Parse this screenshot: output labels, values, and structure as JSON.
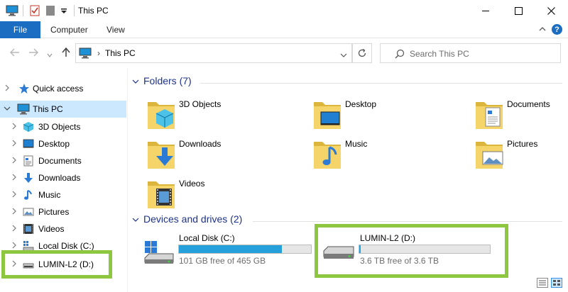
{
  "window": {
    "title": "This PC"
  },
  "ribbon": {
    "tabs": [
      "File",
      "Computer",
      "View"
    ]
  },
  "address": {
    "path": "This PC"
  },
  "search": {
    "placeholder": "Search This PC"
  },
  "nav": {
    "items": [
      {
        "label": "Quick access",
        "icon": "star-icon"
      },
      {
        "label": "This PC",
        "icon": "computer-icon"
      },
      {
        "label": "3D Objects",
        "icon": "3d-objects-icon"
      },
      {
        "label": "Desktop",
        "icon": "desktop-icon"
      },
      {
        "label": "Documents",
        "icon": "documents-icon"
      },
      {
        "label": "Downloads",
        "icon": "downloads-icon"
      },
      {
        "label": "Music",
        "icon": "music-icon"
      },
      {
        "label": "Pictures",
        "icon": "pictures-icon"
      },
      {
        "label": "Videos",
        "icon": "videos-icon"
      },
      {
        "label": "Local Disk (C:)",
        "icon": "drive-icon"
      },
      {
        "label": "LUMIN-L2 (D:)",
        "icon": "usb-drive-icon"
      }
    ]
  },
  "folders": {
    "header": "Folders (7)",
    "items": [
      {
        "label": "3D Objects"
      },
      {
        "label": "Desktop"
      },
      {
        "label": "Documents"
      },
      {
        "label": "Downloads"
      },
      {
        "label": "Music"
      },
      {
        "label": "Pictures"
      },
      {
        "label": "Videos"
      }
    ]
  },
  "drives": {
    "header": "Devices and drives (2)",
    "items": [
      {
        "name": "Local Disk (C:)",
        "free": "101 GB free of 465 GB",
        "used_fraction": 0.78
      },
      {
        "name": "LUMIN-L2 (D:)",
        "free": "3.6 TB free of 3.6 TB",
        "used_fraction": 0.01
      }
    ]
  },
  "colors": {
    "accent": "#1a6dc0",
    "highlight": "#8dc63f",
    "drive_fill": "#26a0da",
    "selected": "#cce8ff"
  }
}
